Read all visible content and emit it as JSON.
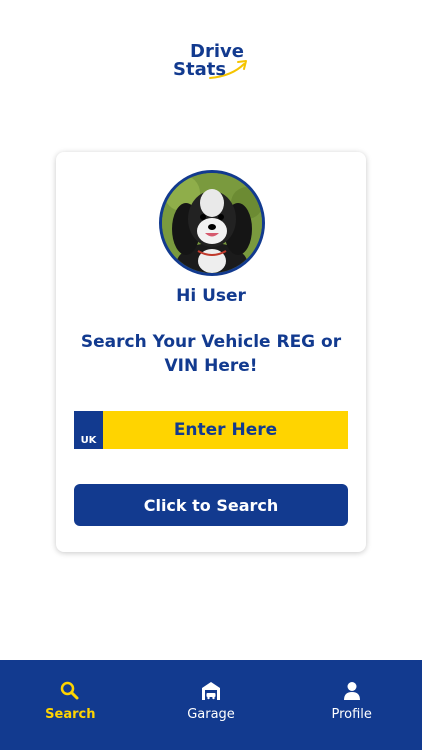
{
  "logo": {
    "line1": "Drive",
    "line2": "Stats"
  },
  "card": {
    "greeting": "Hi User",
    "prompt": "Search Your Vehicle REG or VIN Here!",
    "plate": {
      "country": "UK",
      "placeholder": "Enter Here"
    },
    "search_label": "Click to Search"
  },
  "nav": {
    "items": [
      {
        "label": "Search",
        "icon": "search-icon",
        "active": true
      },
      {
        "label": "Garage",
        "icon": "garage-icon",
        "active": false
      },
      {
        "label": "Profile",
        "icon": "person-icon",
        "active": false
      }
    ]
  },
  "colors": {
    "primary": "#123a8f",
    "accent": "#ffd400"
  }
}
